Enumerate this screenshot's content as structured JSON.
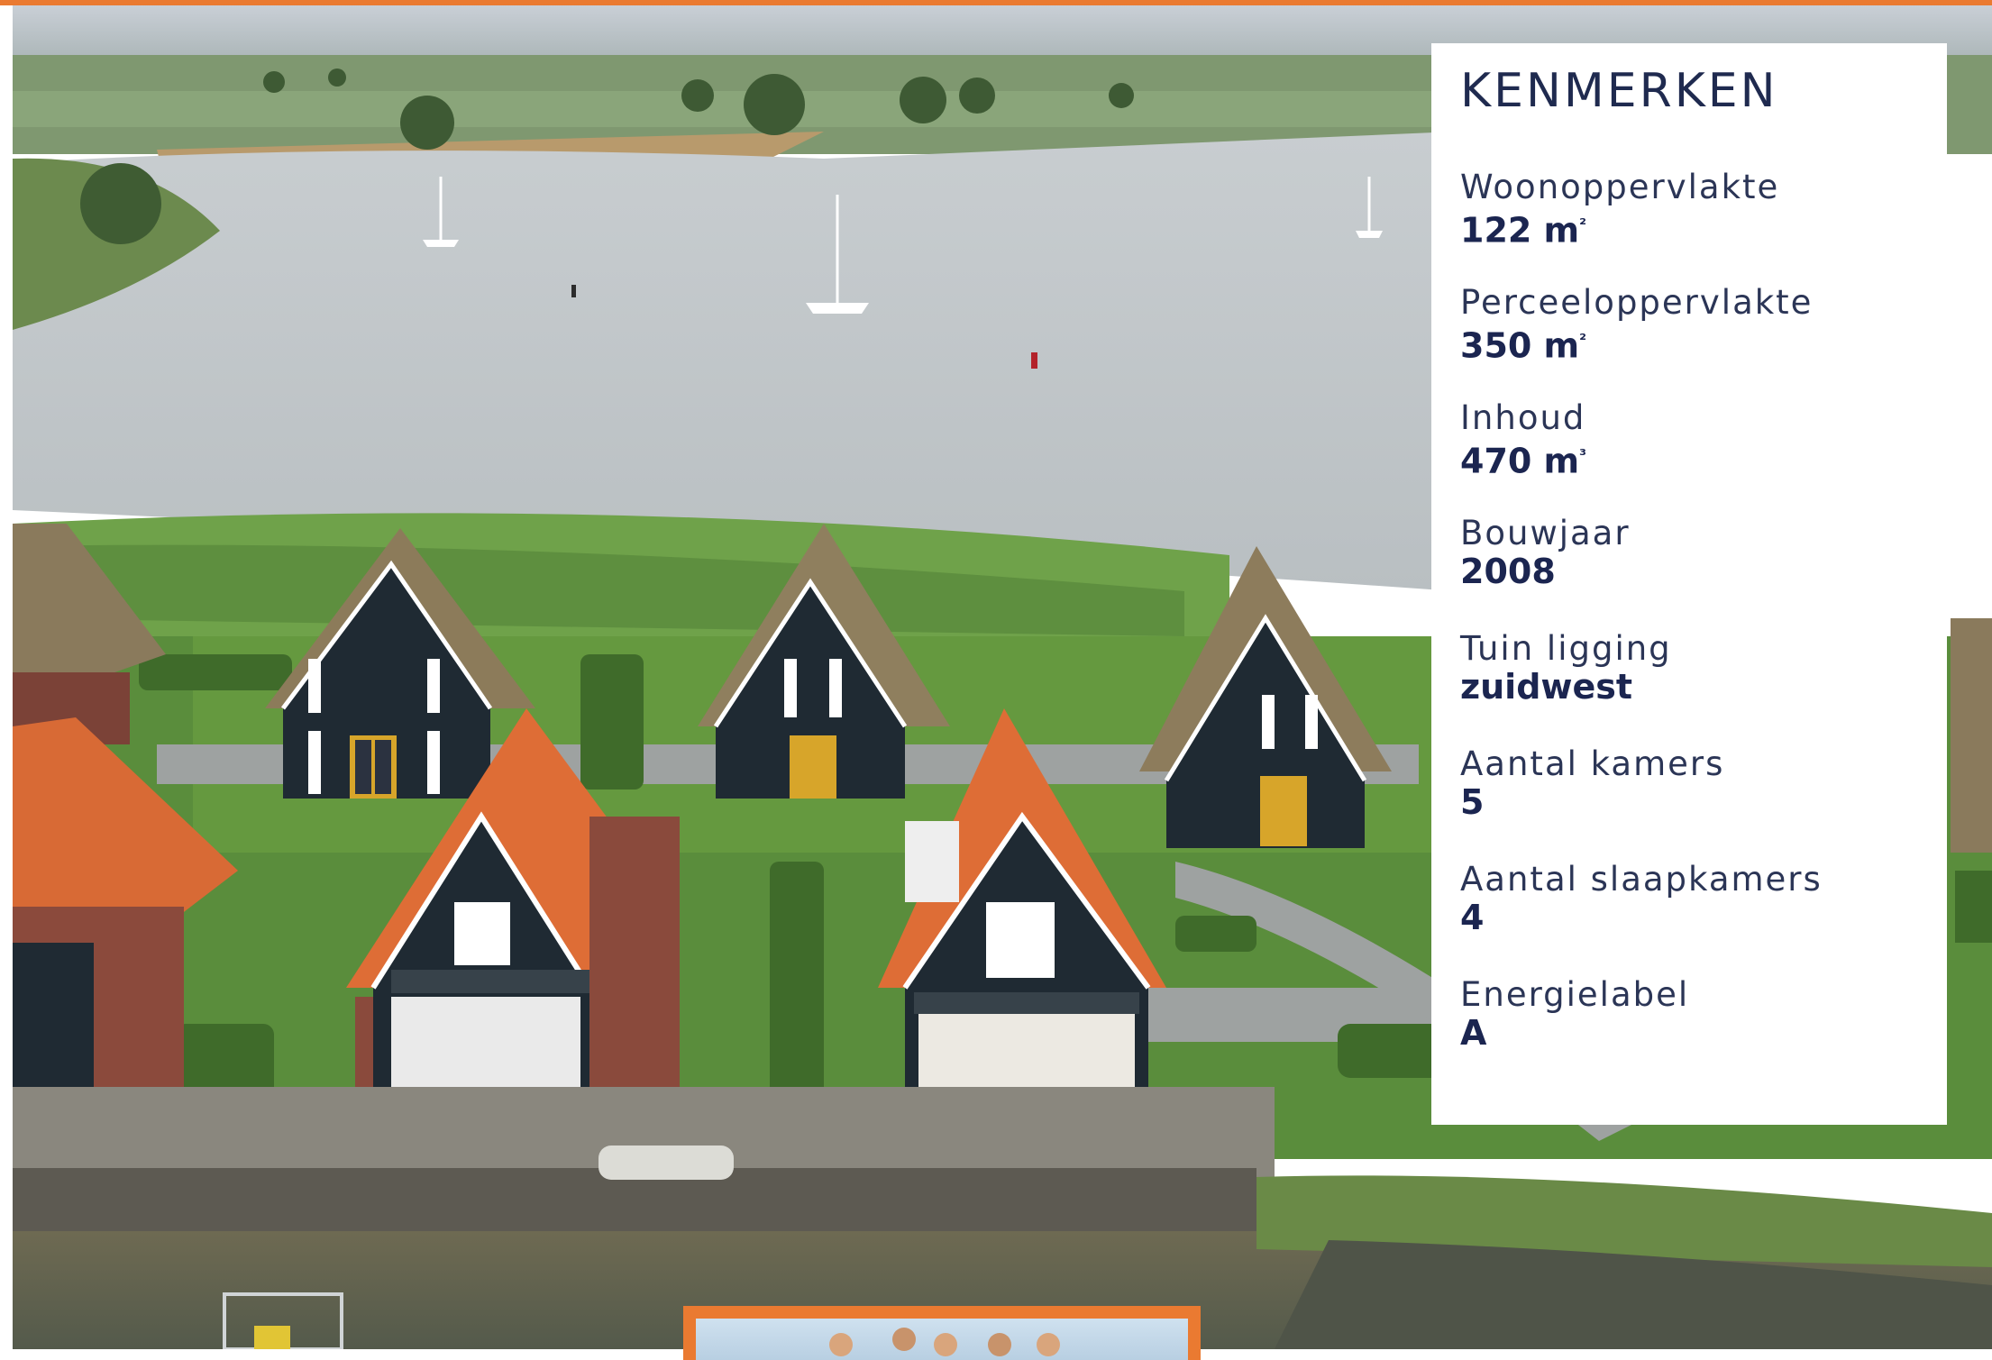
{
  "panel": {
    "title": "KENMERKEN",
    "features": [
      {
        "label": "Woonoppervlakte",
        "value": "122 m",
        "unit_sup": "²"
      },
      {
        "label": "Perceeloppervlakte",
        "value": "350 m",
        "unit_sup": "²"
      },
      {
        "label": "Inhoud",
        "value": "470 m",
        "unit_sup": "³"
      },
      {
        "label": "Bouwjaar",
        "value": "2008",
        "unit_sup": ""
      },
      {
        "label": "Tuin ligging",
        "value": "zuidwest",
        "unit_sup": ""
      },
      {
        "label": "Aantal kamers",
        "value": "5",
        "unit_sup": ""
      },
      {
        "label": "Aantal slaapkamers",
        "value": "4",
        "unit_sup": ""
      },
      {
        "label": "Energielabel",
        "value": "A",
        "unit_sup": ""
      }
    ]
  },
  "colors": {
    "accent": "#ea7a31",
    "navy": "#1f2a4f",
    "panel_bg": "#ffffff"
  },
  "photo": {
    "subject": "aerial-house-photo"
  }
}
